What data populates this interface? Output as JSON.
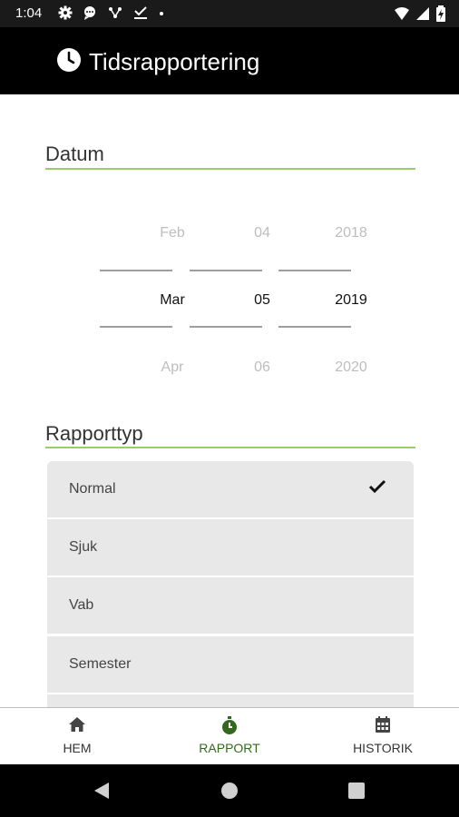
{
  "status_bar": {
    "time": "1:04"
  },
  "app_bar": {
    "title": "Tidsrapportering"
  },
  "date_section": {
    "title": "Datum",
    "months": [
      "Feb",
      "Mar",
      "Apr"
    ],
    "days": [
      "04",
      "05",
      "06"
    ],
    "years": [
      "2018",
      "2019",
      "2020"
    ],
    "selected": {
      "month": "Mar",
      "day": "05",
      "year": "2019"
    }
  },
  "report_section": {
    "title": "Rapporttyp",
    "items": [
      {
        "label": "Normal",
        "selected": true
      },
      {
        "label": "Sjuk",
        "selected": false
      },
      {
        "label": "Vab",
        "selected": false
      },
      {
        "label": "Semester",
        "selected": false
      },
      {
        "label": "",
        "selected": false
      }
    ]
  },
  "bottom_nav": {
    "items": [
      {
        "label": "HEM",
        "icon": "home-icon"
      },
      {
        "label": "RAPPORT",
        "icon": "stopwatch-icon",
        "active": true
      },
      {
        "label": "HISTORIK",
        "icon": "calendar-icon"
      }
    ]
  },
  "colors": {
    "accent": "#9ccc65",
    "active_nav": "#33691e"
  }
}
